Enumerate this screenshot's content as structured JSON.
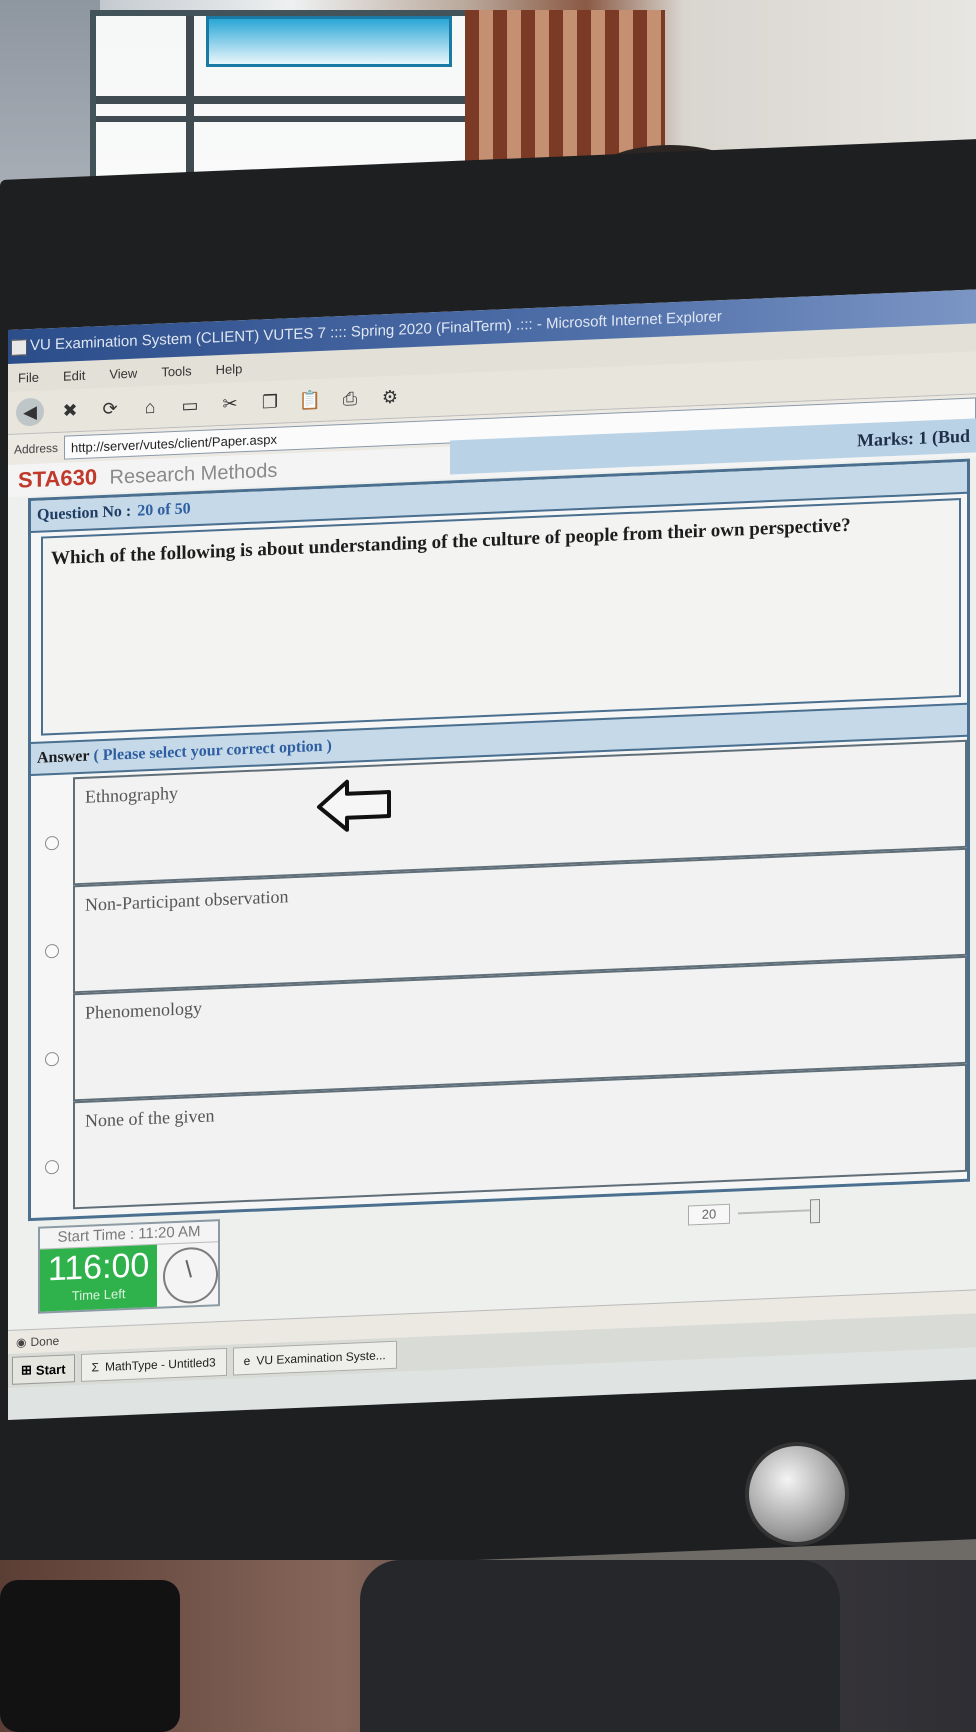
{
  "window": {
    "title": "VU Examination System (CLIENT) VUTES 7 :::: Spring 2020 (FinalTerm) .::: - Microsoft Internet Explorer"
  },
  "menu": [
    "File",
    "Edit",
    "View",
    "Tools",
    "Help"
  ],
  "address": {
    "label": "Address",
    "url": "http://server/vutes/client/Paper.aspx"
  },
  "course": {
    "code": "STA630",
    "name": "Research Methods"
  },
  "marks": "Marks: 1 (Bud",
  "question": {
    "label": "Question No :",
    "number": "20 of 50",
    "text": "Which of the following is about understanding of the culture of people from their own perspective?"
  },
  "answer": {
    "label": "Answer",
    "hint": "( Please select your correct option )",
    "options": [
      {
        "text": "Ethnography",
        "selected": false
      },
      {
        "text": "Non-Participant observation",
        "selected": false
      },
      {
        "text": "Phenomenology",
        "selected": false
      },
      {
        "text": "None of the given",
        "selected": false
      }
    ]
  },
  "timer": {
    "start_time": "Start Time : 11:20 AM",
    "time_left": "116:00",
    "time_left_label": "Time Left"
  },
  "slider": {
    "value": "20"
  },
  "status": {
    "text": "Done"
  },
  "taskbar": {
    "start": "Start",
    "items": [
      "MathType - Untitled3",
      "VU Examination Syste..."
    ]
  },
  "colors": {
    "course_code": "#c0392b",
    "timer_green": "#2fb24c",
    "header_blue": "#c6d9e9"
  }
}
